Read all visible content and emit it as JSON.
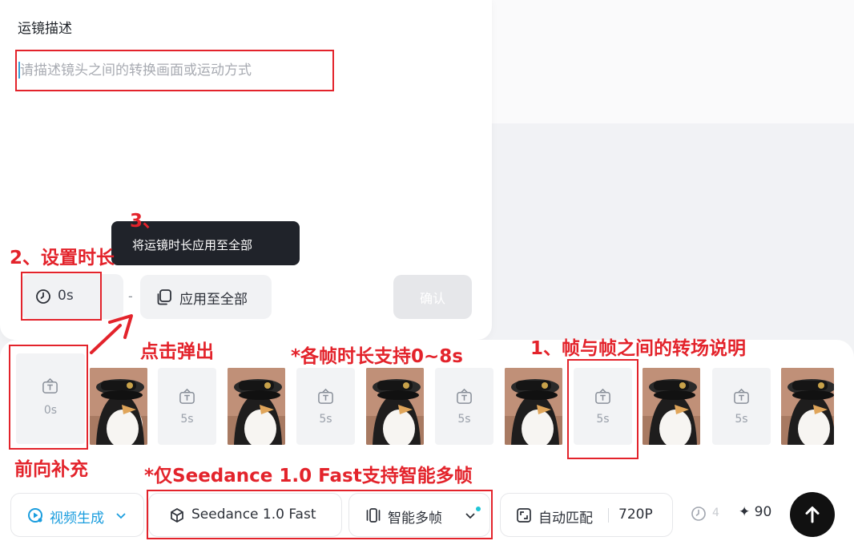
{
  "popup": {
    "title": "运镜描述",
    "input_placeholder": "请描述镜头之间的转换画面或运动方式",
    "tooltip": "将运镜时长应用至全部",
    "duration_value": "0s",
    "dash": "-",
    "apply_all_label": "应用至全部",
    "confirm_label": "确认"
  },
  "frames": {
    "first_slot_label": "0s",
    "slot_labels": [
      "5s",
      "5s",
      "5s",
      "5s",
      "5s"
    ]
  },
  "toolbar": {
    "mode_label": "视频生成",
    "model_label": "Seedance 1.0 Fast",
    "multi_frame_label": "智能多帧",
    "ratio_label": "自动匹配",
    "resolution_label": "720P",
    "duration_partial": "4",
    "credits_label": "90"
  },
  "annotations": {
    "step3": "3、",
    "step2": "2、设置时长",
    "click_popup": "点击弹出",
    "frame_duration_note": "*各帧时长支持0~8s",
    "step1": "1、帧与帧之间的转场说明",
    "forward_fill": "前向补充",
    "seedance_note": "*仅Seedance 1.0 Fast支持智能多帧"
  },
  "colors": {
    "annotation_red": "#e3232b",
    "accent_blue": "#1a9dde",
    "tooltip_bg": "#20232a",
    "submit_bg": "#111111"
  }
}
